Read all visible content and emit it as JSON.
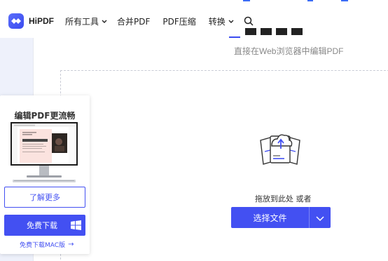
{
  "brand": {
    "name": "HiPDF",
    "color": "#4350f2"
  },
  "nav": {
    "items": [
      {
        "label": "所有工具",
        "has_caret": true
      },
      {
        "label": "合并PDF",
        "has_caret": false
      },
      {
        "label": "PDF压缩",
        "has_caret": false
      },
      {
        "label": "转换",
        "has_caret": true
      }
    ],
    "search_icon": "search-icon"
  },
  "main": {
    "subtitle": "直接在Web浏览器中编辑PDF",
    "drop_text": "拖放到此处 或者",
    "select_button": "选择文件",
    "dropdown_icon": "chevron-down-icon"
  },
  "promo": {
    "title": "编辑PDF更流畅",
    "learn_more": "了解更多",
    "download": "免费下载",
    "mac_link": "免费下载MAC版",
    "mac_arrow": "→"
  }
}
